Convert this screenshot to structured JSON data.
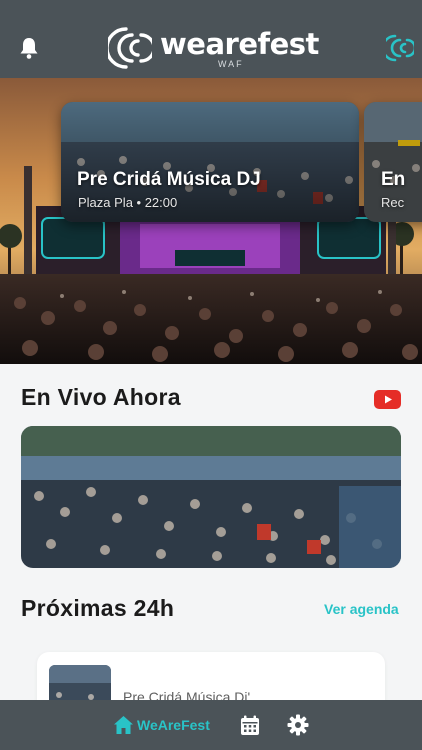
{
  "header": {
    "logo_word": "wearefest",
    "logo_sub": "WAF"
  },
  "carousel": {
    "items": [
      {
        "title": "Pre Cridá Música DJ",
        "subtitle": "Plaza Pla • 22:00"
      },
      {
        "title": "En",
        "subtitle": "Rec"
      }
    ]
  },
  "live": {
    "title": "En Vivo Ahora"
  },
  "upcoming": {
    "title": "Próximas 24h",
    "link_label": "Ver agenda",
    "items": [
      {
        "name": "Pre Cridá Música Dj'"
      }
    ]
  },
  "nav": {
    "home_label": "WeAreFest"
  },
  "colors": {
    "bar": "#4b5358",
    "accent": "#29c3c7",
    "youtube": "#e52d27"
  }
}
